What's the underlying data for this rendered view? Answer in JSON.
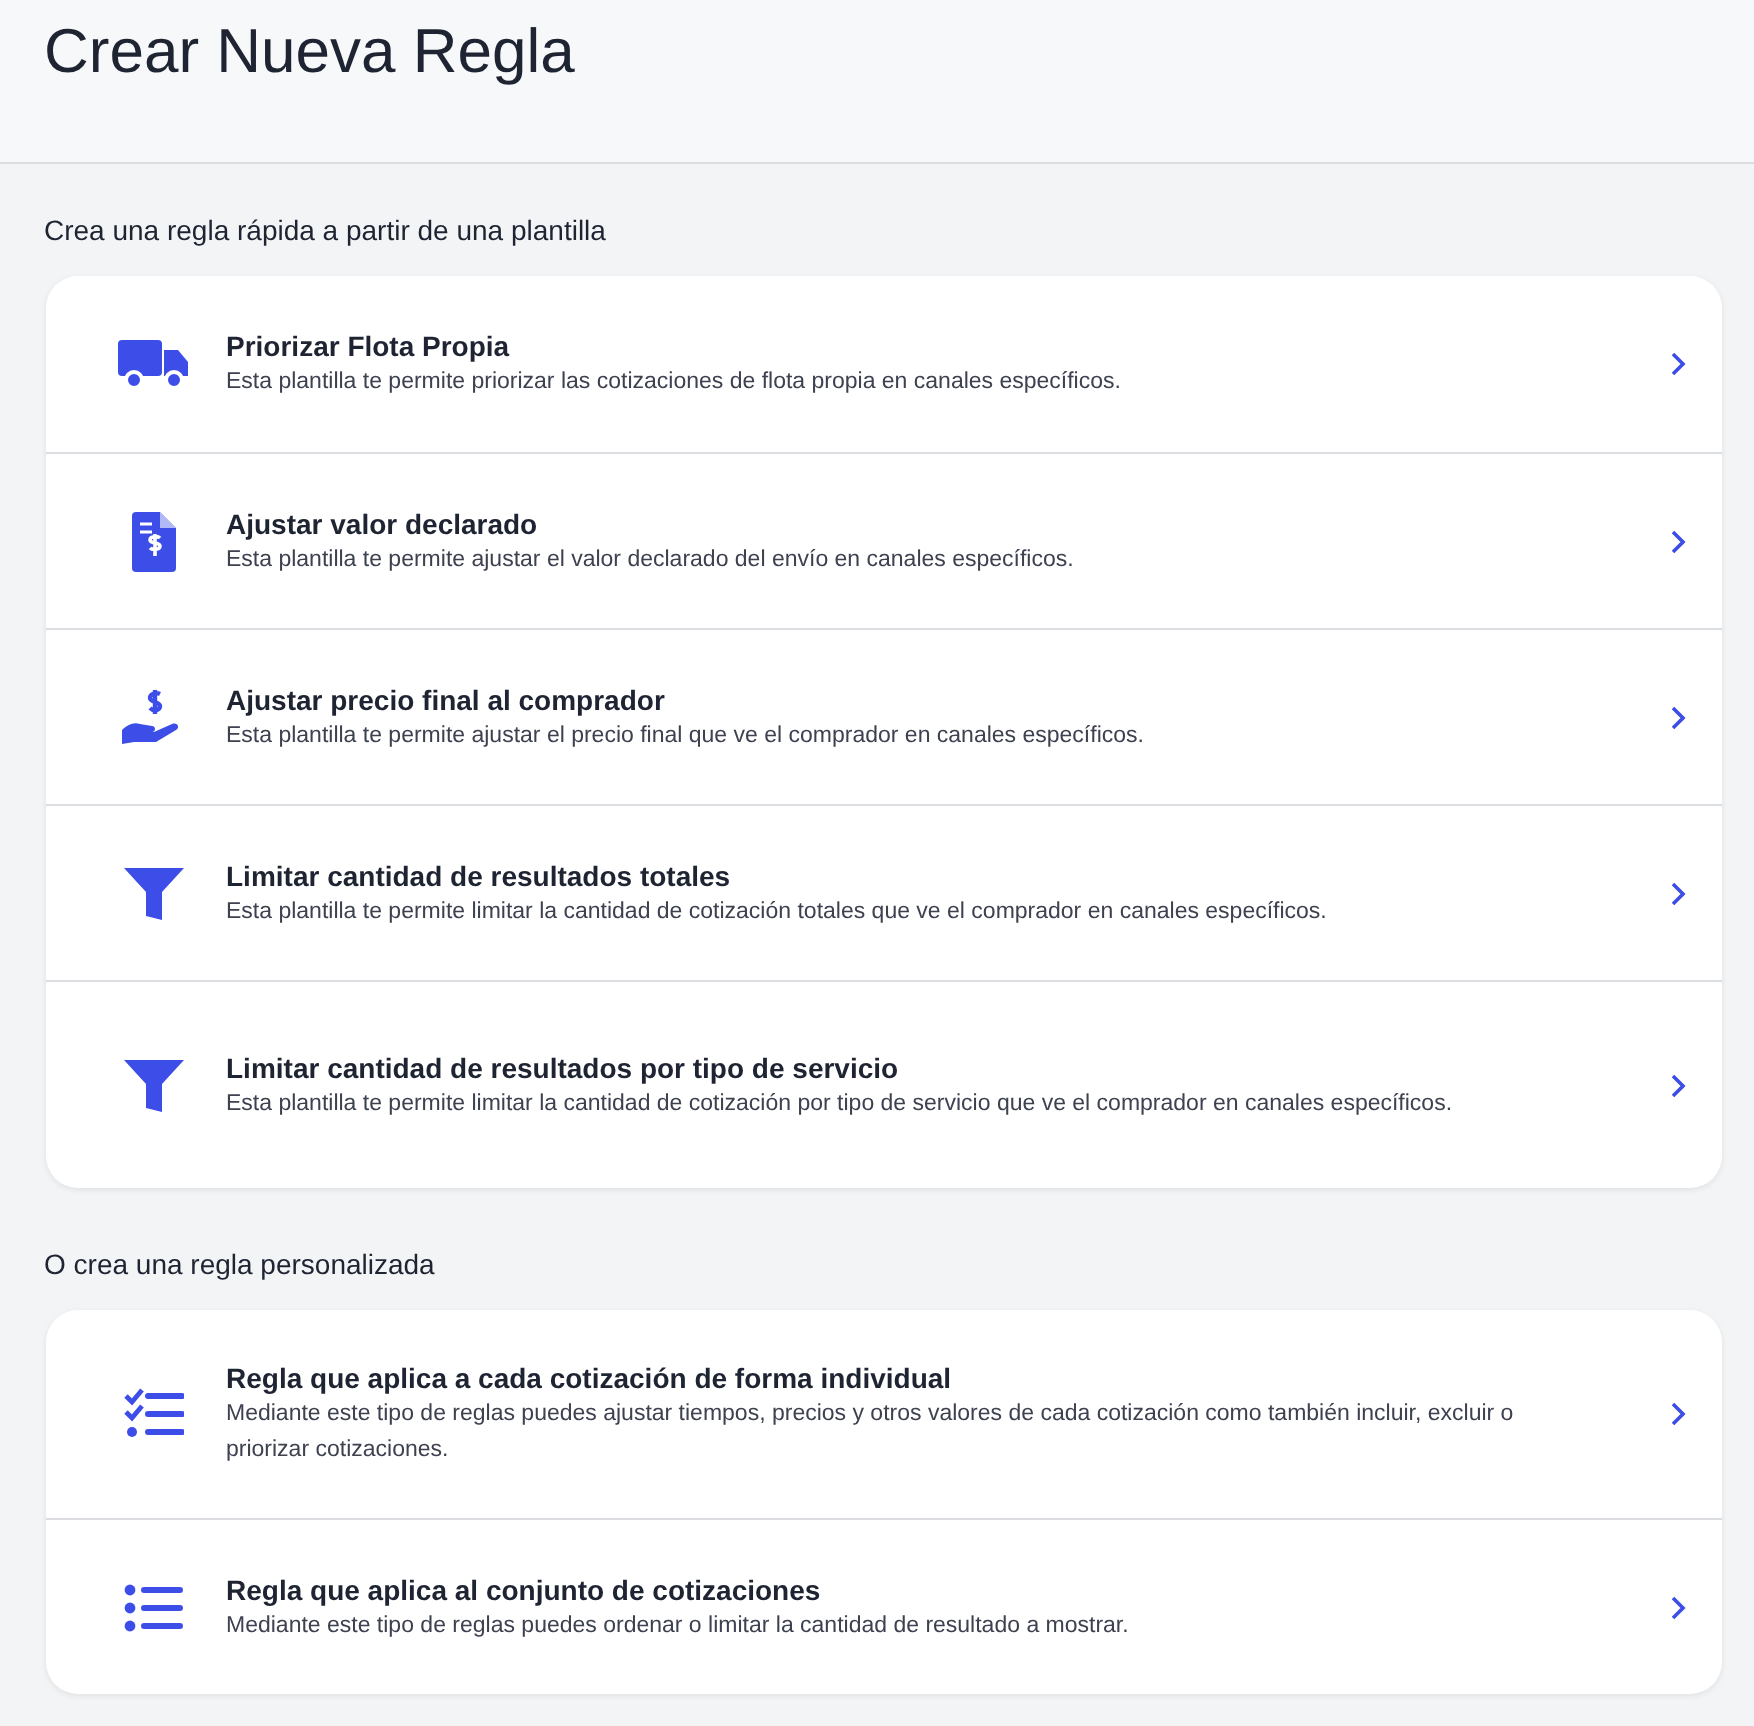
{
  "page_title": "Crear Nueva Regla",
  "sections": [
    {
      "heading": "Crea una regla rápida a partir de una plantilla",
      "items": [
        {
          "kind": "truck",
          "title": "Priorizar Flota Propia",
          "description": "Esta plantilla te permite priorizar las cotizaciones de flota propia en canales específicos."
        },
        {
          "kind": "invoice",
          "title": "Ajustar valor declarado",
          "description": "Esta plantilla te permite ajustar el valor declarado del envío en canales específicos."
        },
        {
          "kind": "hand",
          "title": "Ajustar precio final al comprador",
          "description": "Esta plantilla te permite ajustar el precio final que ve el comprador en canales específicos."
        },
        {
          "kind": "funnel",
          "title": "Limitar cantidad de resultados totales",
          "description": "Esta plantilla te permite limitar la cantidad de cotización totales que ve el comprador en canales específicos."
        },
        {
          "kind": "funnel",
          "title": "Limitar cantidad de resultados por tipo de servicio",
          "description": "Esta plantilla te permite limitar la cantidad de cotización por tipo de servicio que ve el comprador en canales específicos."
        }
      ]
    },
    {
      "heading": "O crea una regla personalizada",
      "items": [
        {
          "kind": "checklist",
          "title": "Regla que aplica a cada cotización de forma individual",
          "description": "Mediante este tipo de reglas puedes ajustar tiempos, precios y otros valores de cada cotización como también incluir, excluir o priorizar cotizaciones."
        },
        {
          "kind": "list",
          "title": "Regla que aplica al conjunto de cotizaciones",
          "description": "Mediante este tipo de reglas puedes ordenar o limitar la cantidad de resultado a mostrar."
        }
      ]
    }
  ]
}
